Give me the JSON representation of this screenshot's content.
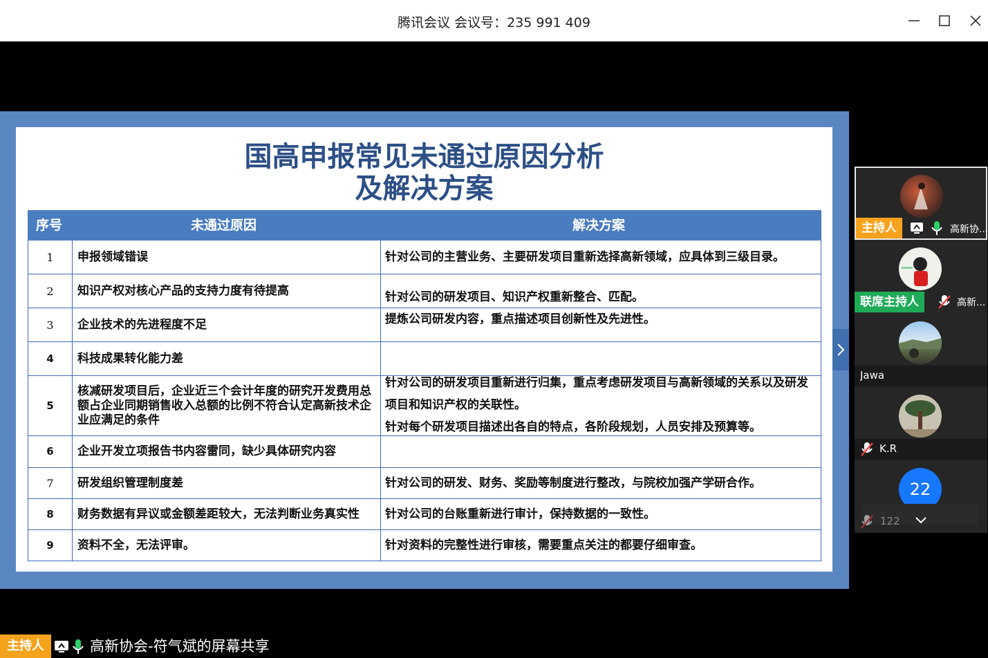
{
  "window": {
    "title": "腾讯会议 会议号：235 991 409"
  },
  "slide": {
    "title_line1": "国高申报常见未通过原因分析",
    "title_line2": "及解决方案",
    "headers": {
      "num": "序号",
      "reason": "未通过原因",
      "solution": "解决方案"
    },
    "rows": [
      {
        "num": "1",
        "reason": "申报领域错误"
      },
      {
        "num": "2",
        "reason": "知识产权对核心产品的支持力度有待提高"
      },
      {
        "num": "3",
        "reason": "企业技术的先进程度不足"
      },
      {
        "num": "4",
        "reason": "科技成果转化能力差"
      },
      {
        "num": "5",
        "reason": "核减研发项目后，企业近三个会计年度的研究开发费用总额占企业同期销售收入总额的比例不符合认定高新技术企业应满足的条件"
      },
      {
        "num": "6",
        "reason": "企业开发立项报告书内容雷同，缺少具体研究内容"
      },
      {
        "num": "7",
        "reason": "研发组织管理制度差"
      },
      {
        "num": "8",
        "reason": "财务数据有异议或金额差距较大，无法判断业务真实性"
      },
      {
        "num": "9",
        "reason": "资料不全，无法评审。"
      }
    ],
    "solutions": {
      "s1": "针对公司的主营业务、主要研发项目重新选择高新领域，应具体到三级目录。",
      "s23_a": "针对公司的研发项目、知识产权重新整合、匹配。",
      "s23_b": "提炼公司研发内容，重点描述项目创新性及先进性。",
      "s456_a": "针对公司的研发项目重新进行归集，重点考虑研发项目与高新领域的关系以及研发项目和知识产权的关联性。",
      "s456_b": "针对每个研发项目描述出各自的特点，各阶段规划，人员安排及预算等。",
      "s7": "针对公司的研发、财务、奖励等制度进行整改，与院校加强产学研合作。",
      "s8": "针对公司的台账重新进行审计，保持数据的一致性。",
      "s9": "针对资料的完整性进行审核，需要重点关注的都要仔细审查。"
    }
  },
  "participants": [
    {
      "badge": "主持人",
      "name": "高新协..."
    },
    {
      "badge": "联席主持人",
      "name": "高新..."
    },
    {
      "name": "Jawa"
    },
    {
      "name": "K.R"
    }
  ],
  "more_participants": {
    "count": "22",
    "total": "122"
  },
  "bottom": {
    "host_badge": "主持人",
    "share_text": "高新协会-符气斌的屏幕共享"
  },
  "colors": {
    "slide_frame": "#5a87c2",
    "title_blue": "#2c4f86",
    "header_blue": "#4a7cc0",
    "host_orange": "#f5a21c",
    "cohost_green": "#1faa58",
    "count_blue": "#1677ff"
  }
}
